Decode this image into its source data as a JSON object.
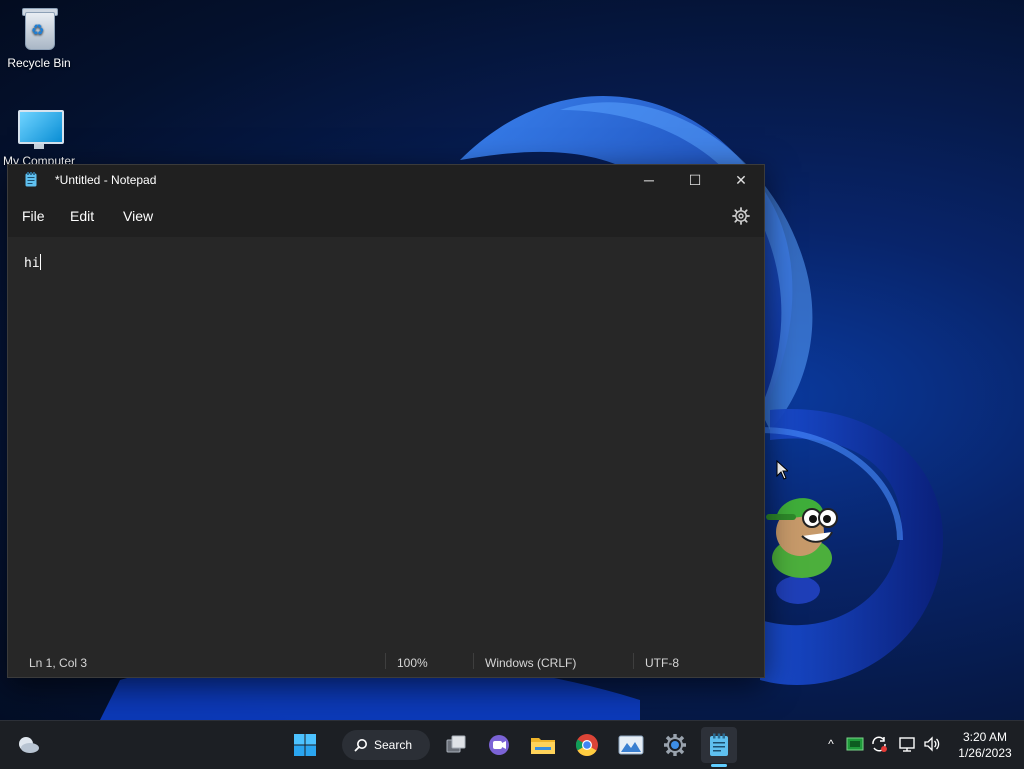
{
  "desktop": {
    "icons": [
      {
        "label": "Recycle Bin",
        "icon": "recycle-bin-icon"
      },
      {
        "label": "My Computer",
        "icon": "computer-icon"
      }
    ]
  },
  "notepad": {
    "title": "*Untitled - Notepad",
    "controls": {
      "minimize": "─",
      "maximize": "☐",
      "close": "✕"
    },
    "menu": [
      {
        "label": "File"
      },
      {
        "label": "Edit"
      },
      {
        "label": "View"
      }
    ],
    "content": "hi",
    "status": {
      "position": "Ln 1, Col 3",
      "zoom": "100%",
      "line_ending": "Windows (CRLF)",
      "encoding": "UTF-8"
    }
  },
  "taskbar": {
    "search_label": "Search",
    "apps": [
      "start-icon",
      "task-view-icon",
      "teams-chat-icon",
      "file-explorer-icon",
      "chrome-icon",
      "photos-icon",
      "settings-icon",
      "notepad-icon"
    ],
    "tray": {
      "expand": "^"
    },
    "clock": {
      "time": "3:20 AM",
      "date": "1/26/2023"
    }
  },
  "colors": {
    "accent": "#60cdff",
    "window_bg": "#272727",
    "titlebar_bg": "#202020"
  }
}
